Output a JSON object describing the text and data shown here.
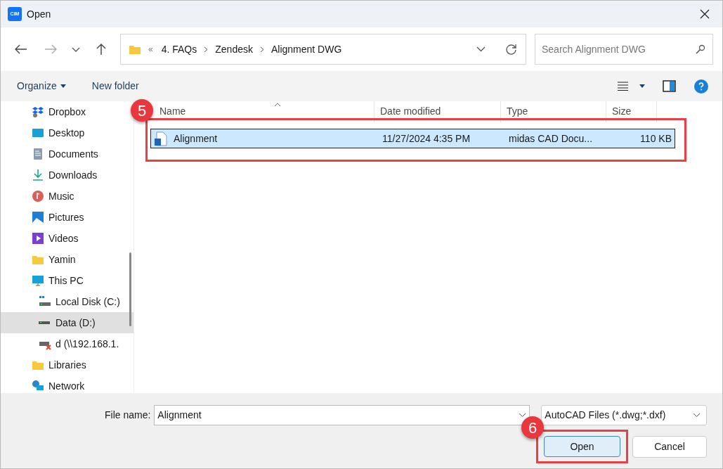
{
  "window": {
    "app_icon": "CIM",
    "title": "Open"
  },
  "address_bar": {
    "overflow": "«",
    "path": [
      "4. FAQs",
      "Zendesk",
      "Alignment DWG"
    ]
  },
  "search": {
    "placeholder": "Search Alignment DWG"
  },
  "toolbar": {
    "organize": "Organize",
    "new_folder": "New folder"
  },
  "sidebar": {
    "items": [
      {
        "label": "Dropbox",
        "kind": "dropbox",
        "selected": false
      },
      {
        "label": "Desktop",
        "kind": "desktop",
        "selected": false
      },
      {
        "label": "Documents",
        "kind": "documents",
        "selected": false
      },
      {
        "label": "Downloads",
        "kind": "downloads",
        "selected": false
      },
      {
        "label": "Music",
        "kind": "music",
        "selected": false
      },
      {
        "label": "Pictures",
        "kind": "pictures",
        "selected": false
      },
      {
        "label": "Videos",
        "kind": "videos",
        "selected": false
      },
      {
        "label": "Yamin",
        "kind": "folder",
        "selected": false
      },
      {
        "label": "This PC",
        "kind": "pc",
        "selected": false,
        "children": [
          {
            "label": "Local Disk (C:)",
            "kind": "sysdrive",
            "selected": false
          },
          {
            "label": "Data (D:)",
            "kind": "drive",
            "selected": true
          },
          {
            "label": "d (\\\\192.168.1.",
            "kind": "netdrive",
            "selected": false
          }
        ]
      },
      {
        "label": "Libraries",
        "kind": "folder",
        "selected": false
      },
      {
        "label": "Network",
        "kind": "network",
        "selected": false
      }
    ]
  },
  "table": {
    "columns": [
      "Name",
      "Date modified",
      "Type",
      "Size"
    ],
    "rows": [
      {
        "name": "Alignment",
        "date_modified": "11/27/2024 4:35 PM",
        "type": "midas CAD Docu...",
        "size": "110 KB",
        "selected": true
      }
    ]
  },
  "footer": {
    "file_name_label": "File name:",
    "file_name": "Alignment",
    "file_type": "AutoCAD Files (*.dwg;*.dxf)",
    "buttons": [
      "Open",
      "Cancel"
    ]
  },
  "annotations": [
    {
      "label": "5"
    },
    {
      "label": "6"
    }
  ]
}
